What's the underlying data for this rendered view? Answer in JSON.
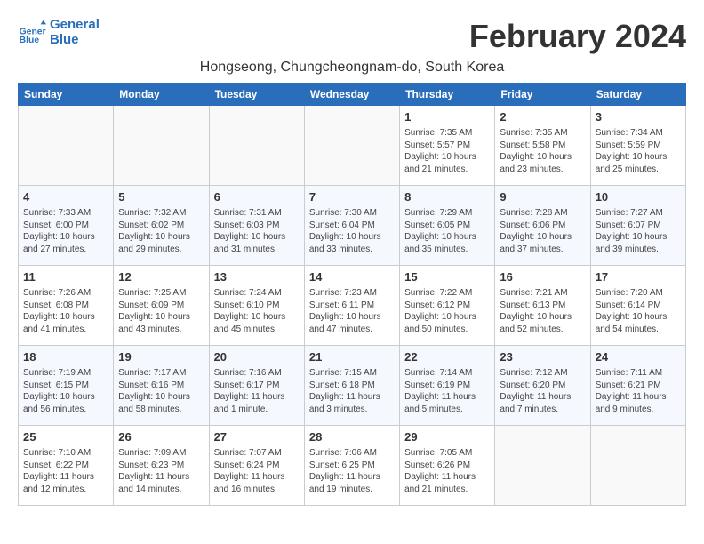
{
  "header": {
    "logo_line1": "General",
    "logo_line2": "Blue",
    "title": "February 2024",
    "subtitle": "Hongseong, Chungcheongnam-do, South Korea"
  },
  "days": [
    "Sunday",
    "Monday",
    "Tuesday",
    "Wednesday",
    "Thursday",
    "Friday",
    "Saturday"
  ],
  "weeks": [
    [
      {
        "date": "",
        "info": ""
      },
      {
        "date": "",
        "info": ""
      },
      {
        "date": "",
        "info": ""
      },
      {
        "date": "",
        "info": ""
      },
      {
        "date": "1",
        "info": "Sunrise: 7:35 AM\nSunset: 5:57 PM\nDaylight: 10 hours\nand 21 minutes."
      },
      {
        "date": "2",
        "info": "Sunrise: 7:35 AM\nSunset: 5:58 PM\nDaylight: 10 hours\nand 23 minutes."
      },
      {
        "date": "3",
        "info": "Sunrise: 7:34 AM\nSunset: 5:59 PM\nDaylight: 10 hours\nand 25 minutes."
      }
    ],
    [
      {
        "date": "4",
        "info": "Sunrise: 7:33 AM\nSunset: 6:00 PM\nDaylight: 10 hours\nand 27 minutes."
      },
      {
        "date": "5",
        "info": "Sunrise: 7:32 AM\nSunset: 6:02 PM\nDaylight: 10 hours\nand 29 minutes."
      },
      {
        "date": "6",
        "info": "Sunrise: 7:31 AM\nSunset: 6:03 PM\nDaylight: 10 hours\nand 31 minutes."
      },
      {
        "date": "7",
        "info": "Sunrise: 7:30 AM\nSunset: 6:04 PM\nDaylight: 10 hours\nand 33 minutes."
      },
      {
        "date": "8",
        "info": "Sunrise: 7:29 AM\nSunset: 6:05 PM\nDaylight: 10 hours\nand 35 minutes."
      },
      {
        "date": "9",
        "info": "Sunrise: 7:28 AM\nSunset: 6:06 PM\nDaylight: 10 hours\nand 37 minutes."
      },
      {
        "date": "10",
        "info": "Sunrise: 7:27 AM\nSunset: 6:07 PM\nDaylight: 10 hours\nand 39 minutes."
      }
    ],
    [
      {
        "date": "11",
        "info": "Sunrise: 7:26 AM\nSunset: 6:08 PM\nDaylight: 10 hours\nand 41 minutes."
      },
      {
        "date": "12",
        "info": "Sunrise: 7:25 AM\nSunset: 6:09 PM\nDaylight: 10 hours\nand 43 minutes."
      },
      {
        "date": "13",
        "info": "Sunrise: 7:24 AM\nSunset: 6:10 PM\nDaylight: 10 hours\nand 45 minutes."
      },
      {
        "date": "14",
        "info": "Sunrise: 7:23 AM\nSunset: 6:11 PM\nDaylight: 10 hours\nand 47 minutes."
      },
      {
        "date": "15",
        "info": "Sunrise: 7:22 AM\nSunset: 6:12 PM\nDaylight: 10 hours\nand 50 minutes."
      },
      {
        "date": "16",
        "info": "Sunrise: 7:21 AM\nSunset: 6:13 PM\nDaylight: 10 hours\nand 52 minutes."
      },
      {
        "date": "17",
        "info": "Sunrise: 7:20 AM\nSunset: 6:14 PM\nDaylight: 10 hours\nand 54 minutes."
      }
    ],
    [
      {
        "date": "18",
        "info": "Sunrise: 7:19 AM\nSunset: 6:15 PM\nDaylight: 10 hours\nand 56 minutes."
      },
      {
        "date": "19",
        "info": "Sunrise: 7:17 AM\nSunset: 6:16 PM\nDaylight: 10 hours\nand 58 minutes."
      },
      {
        "date": "20",
        "info": "Sunrise: 7:16 AM\nSunset: 6:17 PM\nDaylight: 11 hours\nand 1 minute."
      },
      {
        "date": "21",
        "info": "Sunrise: 7:15 AM\nSunset: 6:18 PM\nDaylight: 11 hours\nand 3 minutes."
      },
      {
        "date": "22",
        "info": "Sunrise: 7:14 AM\nSunset: 6:19 PM\nDaylight: 11 hours\nand 5 minutes."
      },
      {
        "date": "23",
        "info": "Sunrise: 7:12 AM\nSunset: 6:20 PM\nDaylight: 11 hours\nand 7 minutes."
      },
      {
        "date": "24",
        "info": "Sunrise: 7:11 AM\nSunset: 6:21 PM\nDaylight: 11 hours\nand 9 minutes."
      }
    ],
    [
      {
        "date": "25",
        "info": "Sunrise: 7:10 AM\nSunset: 6:22 PM\nDaylight: 11 hours\nand 12 minutes."
      },
      {
        "date": "26",
        "info": "Sunrise: 7:09 AM\nSunset: 6:23 PM\nDaylight: 11 hours\nand 14 minutes."
      },
      {
        "date": "27",
        "info": "Sunrise: 7:07 AM\nSunset: 6:24 PM\nDaylight: 11 hours\nand 16 minutes."
      },
      {
        "date": "28",
        "info": "Sunrise: 7:06 AM\nSunset: 6:25 PM\nDaylight: 11 hours\nand 19 minutes."
      },
      {
        "date": "29",
        "info": "Sunrise: 7:05 AM\nSunset: 6:26 PM\nDaylight: 11 hours\nand 21 minutes."
      },
      {
        "date": "",
        "info": ""
      },
      {
        "date": "",
        "info": ""
      }
    ]
  ]
}
